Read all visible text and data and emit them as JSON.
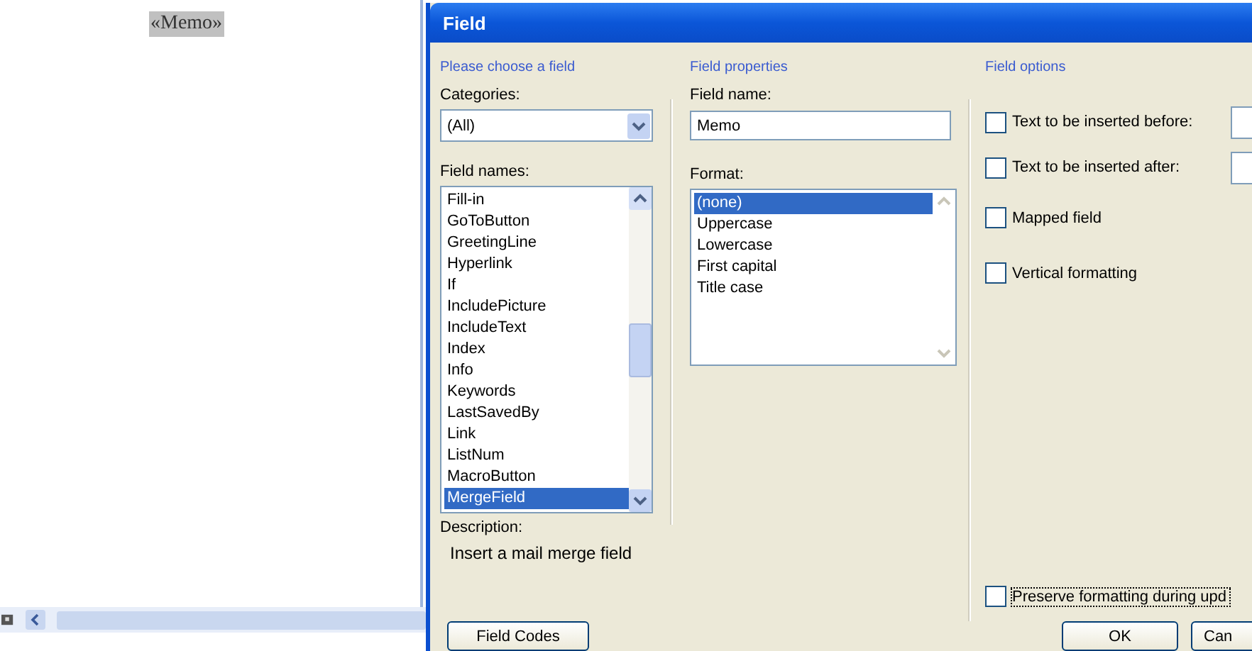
{
  "document": {
    "merge_field": "«Memo»"
  },
  "dialog": {
    "title": "Field",
    "choose": {
      "heading": "Please choose a field",
      "categories_label": "Categories:",
      "category": "(All)",
      "field_names_label": "Field names:",
      "field_names": [
        {
          "label": "Fill-in",
          "selected": false
        },
        {
          "label": "GoToButton",
          "selected": false
        },
        {
          "label": "GreetingLine",
          "selected": false
        },
        {
          "label": "Hyperlink",
          "selected": false
        },
        {
          "label": "If",
          "selected": false
        },
        {
          "label": "IncludePicture",
          "selected": false
        },
        {
          "label": "IncludeText",
          "selected": false
        },
        {
          "label": "Index",
          "selected": false
        },
        {
          "label": "Info",
          "selected": false
        },
        {
          "label": "Keywords",
          "selected": false
        },
        {
          "label": "LastSavedBy",
          "selected": false
        },
        {
          "label": "Link",
          "selected": false
        },
        {
          "label": "ListNum",
          "selected": false
        },
        {
          "label": "MacroButton",
          "selected": false
        },
        {
          "label": "MergeField",
          "selected": true
        }
      ],
      "description_label": "Description:",
      "description": "Insert a mail merge field"
    },
    "properties": {
      "heading": "Field properties",
      "field_name_label": "Field name:",
      "field_name": "Memo",
      "format_label": "Format:",
      "formats": [
        {
          "label": "(none)",
          "selected": true
        },
        {
          "label": "Uppercase",
          "selected": false
        },
        {
          "label": "Lowercase",
          "selected": false
        },
        {
          "label": "First capital",
          "selected": false
        },
        {
          "label": "Title case",
          "selected": false
        }
      ]
    },
    "options": {
      "heading": "Field options",
      "items": [
        {
          "kind": "with_input",
          "label": "Text to be inserted before:",
          "checked": false
        },
        {
          "kind": "with_input",
          "label": "Text to be inserted after:",
          "checked": false
        },
        {
          "kind": "plain",
          "label": "Mapped field",
          "checked": false
        },
        {
          "kind": "plain",
          "label": "Vertical formatting",
          "checked": false
        }
      ]
    },
    "preserve": {
      "label": "Preserve formatting during upd",
      "checked": false
    },
    "buttons": [
      {
        "label": "Field Codes"
      },
      {
        "label": "OK"
      },
      {
        "label": "Can"
      }
    ]
  }
}
